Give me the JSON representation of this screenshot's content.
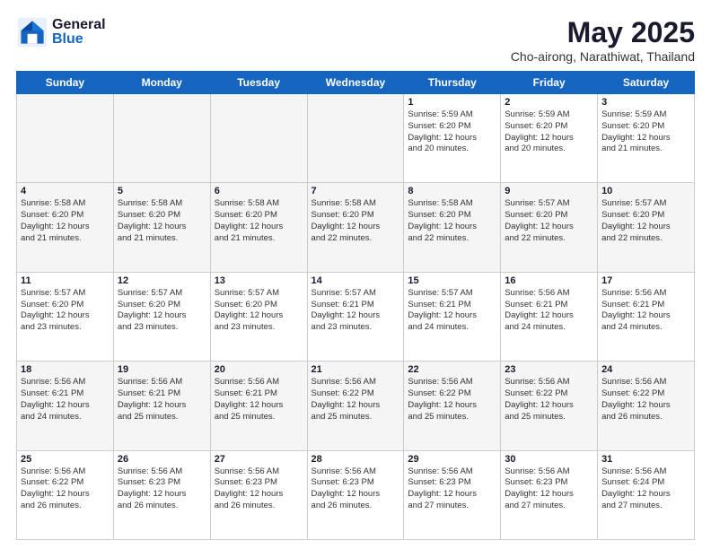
{
  "header": {
    "logo_general": "General",
    "logo_blue": "Blue",
    "month_title": "May 2025",
    "location": "Cho-airong, Narathiwat, Thailand"
  },
  "days_of_week": [
    "Sunday",
    "Monday",
    "Tuesday",
    "Wednesday",
    "Thursday",
    "Friday",
    "Saturday"
  ],
  "weeks": [
    [
      {
        "day": "",
        "info": ""
      },
      {
        "day": "",
        "info": ""
      },
      {
        "day": "",
        "info": ""
      },
      {
        "day": "",
        "info": ""
      },
      {
        "day": "1",
        "info": "Sunrise: 5:59 AM\nSunset: 6:20 PM\nDaylight: 12 hours\nand 20 minutes."
      },
      {
        "day": "2",
        "info": "Sunrise: 5:59 AM\nSunset: 6:20 PM\nDaylight: 12 hours\nand 20 minutes."
      },
      {
        "day": "3",
        "info": "Sunrise: 5:59 AM\nSunset: 6:20 PM\nDaylight: 12 hours\nand 21 minutes."
      }
    ],
    [
      {
        "day": "4",
        "info": "Sunrise: 5:58 AM\nSunset: 6:20 PM\nDaylight: 12 hours\nand 21 minutes."
      },
      {
        "day": "5",
        "info": "Sunrise: 5:58 AM\nSunset: 6:20 PM\nDaylight: 12 hours\nand 21 minutes."
      },
      {
        "day": "6",
        "info": "Sunrise: 5:58 AM\nSunset: 6:20 PM\nDaylight: 12 hours\nand 21 minutes."
      },
      {
        "day": "7",
        "info": "Sunrise: 5:58 AM\nSunset: 6:20 PM\nDaylight: 12 hours\nand 22 minutes."
      },
      {
        "day": "8",
        "info": "Sunrise: 5:58 AM\nSunset: 6:20 PM\nDaylight: 12 hours\nand 22 minutes."
      },
      {
        "day": "9",
        "info": "Sunrise: 5:57 AM\nSunset: 6:20 PM\nDaylight: 12 hours\nand 22 minutes."
      },
      {
        "day": "10",
        "info": "Sunrise: 5:57 AM\nSunset: 6:20 PM\nDaylight: 12 hours\nand 22 minutes."
      }
    ],
    [
      {
        "day": "11",
        "info": "Sunrise: 5:57 AM\nSunset: 6:20 PM\nDaylight: 12 hours\nand 23 minutes."
      },
      {
        "day": "12",
        "info": "Sunrise: 5:57 AM\nSunset: 6:20 PM\nDaylight: 12 hours\nand 23 minutes."
      },
      {
        "day": "13",
        "info": "Sunrise: 5:57 AM\nSunset: 6:20 PM\nDaylight: 12 hours\nand 23 minutes."
      },
      {
        "day": "14",
        "info": "Sunrise: 5:57 AM\nSunset: 6:21 PM\nDaylight: 12 hours\nand 23 minutes."
      },
      {
        "day": "15",
        "info": "Sunrise: 5:57 AM\nSunset: 6:21 PM\nDaylight: 12 hours\nand 24 minutes."
      },
      {
        "day": "16",
        "info": "Sunrise: 5:56 AM\nSunset: 6:21 PM\nDaylight: 12 hours\nand 24 minutes."
      },
      {
        "day": "17",
        "info": "Sunrise: 5:56 AM\nSunset: 6:21 PM\nDaylight: 12 hours\nand 24 minutes."
      }
    ],
    [
      {
        "day": "18",
        "info": "Sunrise: 5:56 AM\nSunset: 6:21 PM\nDaylight: 12 hours\nand 24 minutes."
      },
      {
        "day": "19",
        "info": "Sunrise: 5:56 AM\nSunset: 6:21 PM\nDaylight: 12 hours\nand 25 minutes."
      },
      {
        "day": "20",
        "info": "Sunrise: 5:56 AM\nSunset: 6:21 PM\nDaylight: 12 hours\nand 25 minutes."
      },
      {
        "day": "21",
        "info": "Sunrise: 5:56 AM\nSunset: 6:22 PM\nDaylight: 12 hours\nand 25 minutes."
      },
      {
        "day": "22",
        "info": "Sunrise: 5:56 AM\nSunset: 6:22 PM\nDaylight: 12 hours\nand 25 minutes."
      },
      {
        "day": "23",
        "info": "Sunrise: 5:56 AM\nSunset: 6:22 PM\nDaylight: 12 hours\nand 25 minutes."
      },
      {
        "day": "24",
        "info": "Sunrise: 5:56 AM\nSunset: 6:22 PM\nDaylight: 12 hours\nand 26 minutes."
      }
    ],
    [
      {
        "day": "25",
        "info": "Sunrise: 5:56 AM\nSunset: 6:22 PM\nDaylight: 12 hours\nand 26 minutes."
      },
      {
        "day": "26",
        "info": "Sunrise: 5:56 AM\nSunset: 6:23 PM\nDaylight: 12 hours\nand 26 minutes."
      },
      {
        "day": "27",
        "info": "Sunrise: 5:56 AM\nSunset: 6:23 PM\nDaylight: 12 hours\nand 26 minutes."
      },
      {
        "day": "28",
        "info": "Sunrise: 5:56 AM\nSunset: 6:23 PM\nDaylight: 12 hours\nand 26 minutes."
      },
      {
        "day": "29",
        "info": "Sunrise: 5:56 AM\nSunset: 6:23 PM\nDaylight: 12 hours\nand 27 minutes."
      },
      {
        "day": "30",
        "info": "Sunrise: 5:56 AM\nSunset: 6:23 PM\nDaylight: 12 hours\nand 27 minutes."
      },
      {
        "day": "31",
        "info": "Sunrise: 5:56 AM\nSunset: 6:24 PM\nDaylight: 12 hours\nand 27 minutes."
      }
    ]
  ]
}
